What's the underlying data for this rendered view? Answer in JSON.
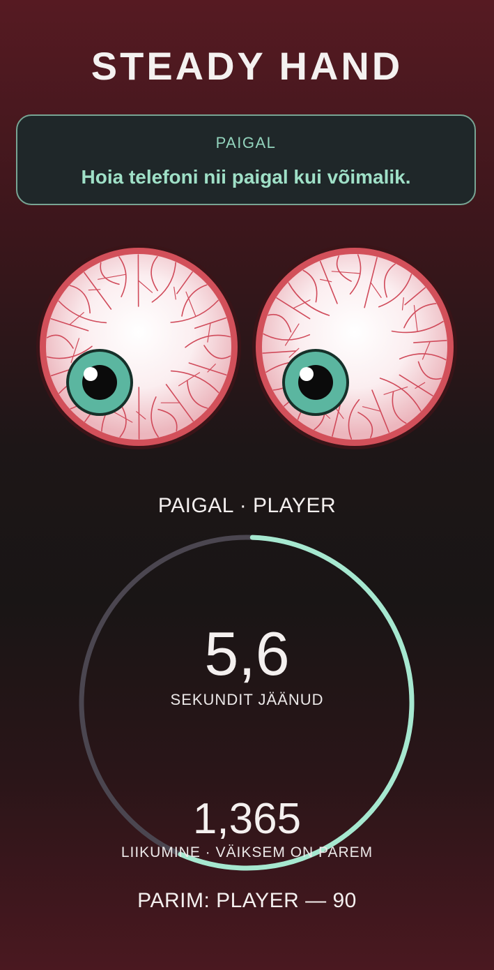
{
  "app": {
    "title": "STEADY HAND"
  },
  "instruction": {
    "mode": "PAIGAL",
    "text": "Hoia telefoni nii paigal kui võimalik."
  },
  "status": {
    "player_label": "PAIGAL · PLAYER"
  },
  "timer": {
    "value": "5,6",
    "caption": "SEKUNDIT JÄÄNUD",
    "fraction_remaining": 0.56
  },
  "movement": {
    "value": "1,365",
    "caption": "LIIKUMINE · VÄIKSEM ON PAREM"
  },
  "best": {
    "text": "PARIM: PLAYER — 90"
  },
  "colors": {
    "accent": "#a6e8d0",
    "ring_track": "#4b4650",
    "eye_rim": "#d2505a",
    "eye_white": "#fbeef0",
    "iris": "#5bb6a0",
    "card_border": "#78a594"
  },
  "icons": {
    "left_eye": "bloodshot-eye-icon",
    "right_eye": "bloodshot-eye-icon"
  }
}
